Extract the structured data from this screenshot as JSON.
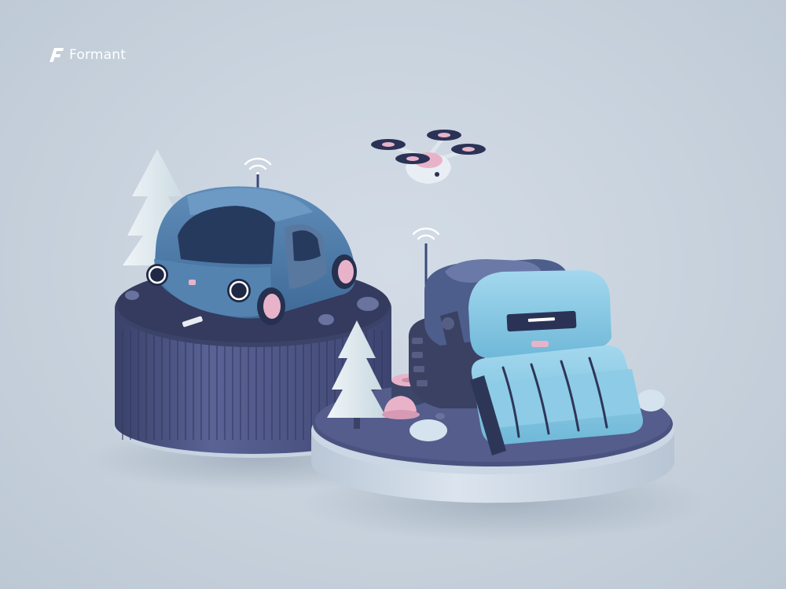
{
  "brand": {
    "name": "Formant",
    "logo_icon": "formant-f-logo"
  },
  "scene": {
    "subjects": [
      "tree-icon",
      "car-icon",
      "drone-icon",
      "wifi-signal-icon",
      "tracked-robot-icon",
      "hard-hat-icon",
      "tree-stump-icon"
    ]
  },
  "palette": {
    "background": "#c9d4de",
    "pedestal_dark": "#4b5482",
    "pedestal_light": "#d2dde8",
    "car_blue": "#4b78a6",
    "robot_cyan": "#87c8e4",
    "accent_pink": "#e8b3c9"
  }
}
